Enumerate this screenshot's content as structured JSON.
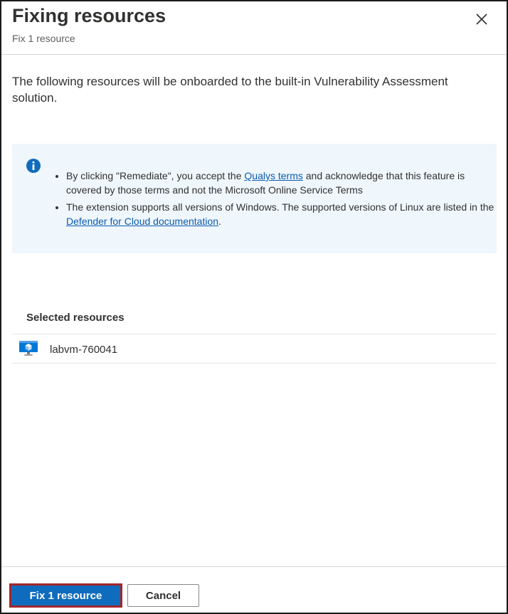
{
  "header": {
    "title": "Fixing resources",
    "subtitle": "Fix 1 resource",
    "close_icon": "close-icon"
  },
  "description": "The following resources will be onboarded to the built-in Vulnerability Assessment solution.",
  "info": {
    "icon": "info-icon",
    "items": [
      {
        "before": "By clicking \"Remediate\", you accept the ",
        "link": "Qualys terms",
        "after": " and acknowledge that this feature is covered by those terms and not the Microsoft Online Service Terms"
      },
      {
        "before": "The extension supports all versions of Windows. The supported versions of Linux are listed in the ",
        "link": "Defender for Cloud documentation",
        "after": "."
      }
    ]
  },
  "selected": {
    "title": "Selected resources",
    "items": [
      {
        "icon": "virtual-machine-icon",
        "name": "labvm-760041"
      }
    ]
  },
  "footer": {
    "primary_label": "Fix 1 resource",
    "secondary_label": "Cancel"
  },
  "colors": {
    "accent": "#0f6cbd",
    "info_bg": "#eff6fc",
    "link": "#0b5cad",
    "focus_border": "#a4262c"
  }
}
